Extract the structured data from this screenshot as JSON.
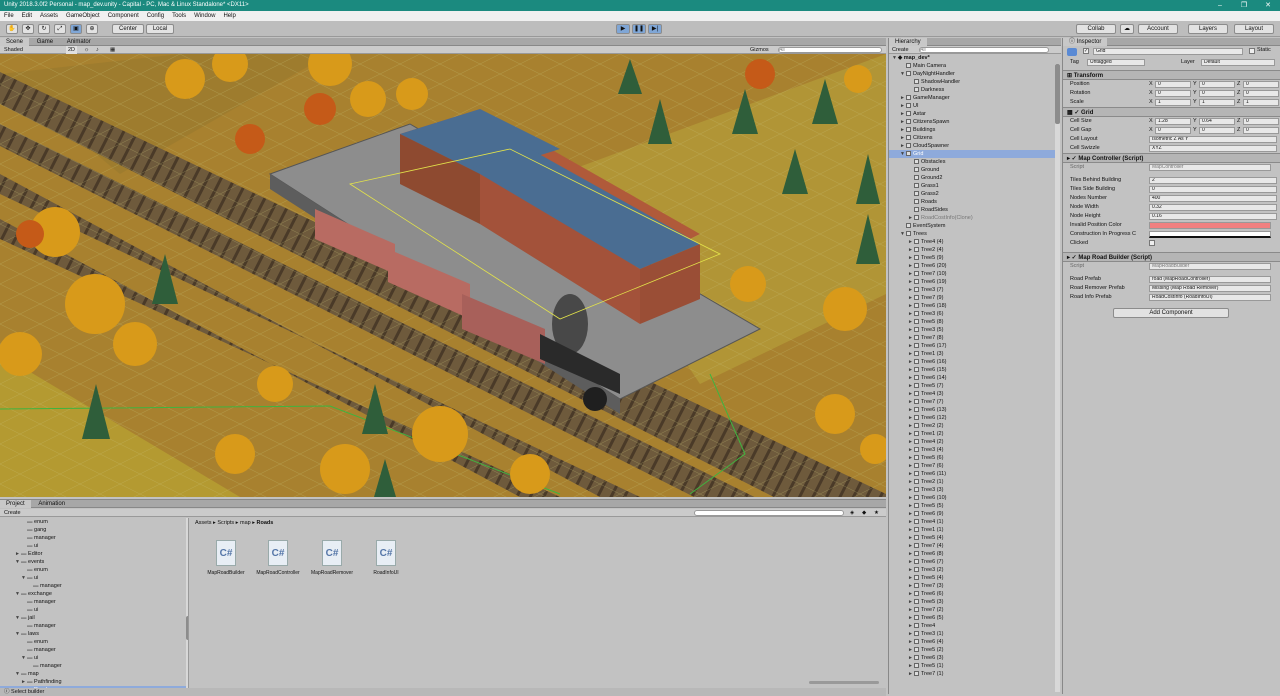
{
  "window": {
    "title": "Unity 2018.3.0f2 Personal - map_dev.unity - Capital - PC, Mac & Linux Standalone* <DX11>"
  },
  "menu": [
    "File",
    "Edit",
    "Assets",
    "GameObject",
    "Component",
    "Config",
    "Tools",
    "Window",
    "Help"
  ],
  "toolbar": {
    "center_label": "Center",
    "local_label": "Local",
    "collab_label": "Collab",
    "account_label": "Account",
    "layers_label": "Layers",
    "layout_label": "Layout"
  },
  "scene": {
    "tabs": [
      "Scene",
      "Game",
      "Animator"
    ],
    "shading": "Shaded",
    "mode2d": "2D",
    "gizmos_label": "Gizmos",
    "search_placeholder": "All"
  },
  "hierarchy": {
    "tab": "Hierarchy",
    "create_label": "Create",
    "search_placeholder": "All",
    "scene_name": "map_dev*",
    "items": [
      {
        "label": "Main Camera",
        "depth": 1,
        "arrow": ""
      },
      {
        "label": "DayNightHandler",
        "depth": 1,
        "arrow": "▼"
      },
      {
        "label": "ShadowHandler",
        "depth": 2,
        "arrow": ""
      },
      {
        "label": "Darkness",
        "depth": 2,
        "arrow": ""
      },
      {
        "label": "GameManager",
        "depth": 1,
        "arrow": "►"
      },
      {
        "label": "UI",
        "depth": 1,
        "arrow": "►"
      },
      {
        "label": "Astar",
        "depth": 1,
        "arrow": "►"
      },
      {
        "label": "CitizensSpawn",
        "depth": 1,
        "arrow": "►"
      },
      {
        "label": "Buildings",
        "depth": 1,
        "arrow": "►"
      },
      {
        "label": "Citizens",
        "depth": 1,
        "arrow": "►"
      },
      {
        "label": "CloudSpawner",
        "depth": 1,
        "arrow": "►"
      },
      {
        "label": "Grid",
        "depth": 1,
        "arrow": "▼",
        "selected": true
      },
      {
        "label": "Obstacles",
        "depth": 2,
        "arrow": ""
      },
      {
        "label": "Ground",
        "depth": 2,
        "arrow": ""
      },
      {
        "label": "Ground2",
        "depth": 2,
        "arrow": ""
      },
      {
        "label": "Grass1",
        "depth": 2,
        "arrow": ""
      },
      {
        "label": "Grass2",
        "depth": 2,
        "arrow": ""
      },
      {
        "label": "Roads",
        "depth": 2,
        "arrow": ""
      },
      {
        "label": "RoadSides",
        "depth": 2,
        "arrow": ""
      },
      {
        "label": "RoadCostInfo(Clone)",
        "depth": 2,
        "arrow": "►",
        "faded": true
      },
      {
        "label": "EventSystem",
        "depth": 1,
        "arrow": ""
      },
      {
        "label": "Trees",
        "depth": 1,
        "arrow": "▼"
      },
      {
        "label": "Tree4 (4)",
        "depth": 2,
        "arrow": "►"
      },
      {
        "label": "Tree2 (4)",
        "depth": 2,
        "arrow": "►"
      },
      {
        "label": "Tree5 (9)",
        "depth": 2,
        "arrow": "►"
      },
      {
        "label": "Tree6 (20)",
        "depth": 2,
        "arrow": "►"
      },
      {
        "label": "Tree7 (10)",
        "depth": 2,
        "arrow": "►"
      },
      {
        "label": "Tree6 (19)",
        "depth": 2,
        "arrow": "►"
      },
      {
        "label": "Tree3 (7)",
        "depth": 2,
        "arrow": "►"
      },
      {
        "label": "Tree7 (9)",
        "depth": 2,
        "arrow": "►"
      },
      {
        "label": "Tree6 (18)",
        "depth": 2,
        "arrow": "►"
      },
      {
        "label": "Tree3 (6)",
        "depth": 2,
        "arrow": "►"
      },
      {
        "label": "Tree5 (8)",
        "depth": 2,
        "arrow": "►"
      },
      {
        "label": "Tree3 (5)",
        "depth": 2,
        "arrow": "►"
      },
      {
        "label": "Tree7 (8)",
        "depth": 2,
        "arrow": "►"
      },
      {
        "label": "Tree6 (17)",
        "depth": 2,
        "arrow": "►"
      },
      {
        "label": "Tree1 (3)",
        "depth": 2,
        "arrow": "►"
      },
      {
        "label": "Tree6 (16)",
        "depth": 2,
        "arrow": "►"
      },
      {
        "label": "Tree6 (15)",
        "depth": 2,
        "arrow": "►"
      },
      {
        "label": "Tree6 (14)",
        "depth": 2,
        "arrow": "►"
      },
      {
        "label": "Tree5 (7)",
        "depth": 2,
        "arrow": "►"
      },
      {
        "label": "Tree4 (3)",
        "depth": 2,
        "arrow": "►"
      },
      {
        "label": "Tree7 (7)",
        "depth": 2,
        "arrow": "►"
      },
      {
        "label": "Tree6 (13)",
        "depth": 2,
        "arrow": "►"
      },
      {
        "label": "Tree6 (12)",
        "depth": 2,
        "arrow": "►"
      },
      {
        "label": "Tree2 (2)",
        "depth": 2,
        "arrow": "►"
      },
      {
        "label": "Tree1 (2)",
        "depth": 2,
        "arrow": "►"
      },
      {
        "label": "Tree4 (2)",
        "depth": 2,
        "arrow": "►"
      },
      {
        "label": "Tree3 (4)",
        "depth": 2,
        "arrow": "►"
      },
      {
        "label": "Tree5 (6)",
        "depth": 2,
        "arrow": "►"
      },
      {
        "label": "Tree7 (6)",
        "depth": 2,
        "arrow": "►"
      },
      {
        "label": "Tree6 (11)",
        "depth": 2,
        "arrow": "►"
      },
      {
        "label": "Tree2 (1)",
        "depth": 2,
        "arrow": "►"
      },
      {
        "label": "Tree3 (3)",
        "depth": 2,
        "arrow": "►"
      },
      {
        "label": "Tree6 (10)",
        "depth": 2,
        "arrow": "►"
      },
      {
        "label": "Tree5 (5)",
        "depth": 2,
        "arrow": "►"
      },
      {
        "label": "Tree6 (9)",
        "depth": 2,
        "arrow": "►"
      },
      {
        "label": "Tree4 (1)",
        "depth": 2,
        "arrow": "►"
      },
      {
        "label": "Tree1 (1)",
        "depth": 2,
        "arrow": "►"
      },
      {
        "label": "Tree5 (4)",
        "depth": 2,
        "arrow": "►"
      },
      {
        "label": "Tree7 (4)",
        "depth": 2,
        "arrow": "►"
      },
      {
        "label": "Tree6 (8)",
        "depth": 2,
        "arrow": "►"
      },
      {
        "label": "Tree6 (7)",
        "depth": 2,
        "arrow": "►"
      },
      {
        "label": "Tree3 (2)",
        "depth": 2,
        "arrow": "►"
      },
      {
        "label": "Tree5 (4)",
        "depth": 2,
        "arrow": "►"
      },
      {
        "label": "Tree7 (3)",
        "depth": 2,
        "arrow": "►"
      },
      {
        "label": "Tree6 (6)",
        "depth": 2,
        "arrow": "►"
      },
      {
        "label": "Tree5 (3)",
        "depth": 2,
        "arrow": "►"
      },
      {
        "label": "Tree7 (2)",
        "depth": 2,
        "arrow": "►"
      },
      {
        "label": "Tree6 (5)",
        "depth": 2,
        "arrow": "►"
      },
      {
        "label": "Tree4",
        "depth": 2,
        "arrow": "►"
      },
      {
        "label": "Tree3 (1)",
        "depth": 2,
        "arrow": "►"
      },
      {
        "label": "Tree6 (4)",
        "depth": 2,
        "arrow": "►"
      },
      {
        "label": "Tree5 (2)",
        "depth": 2,
        "arrow": "►"
      },
      {
        "label": "Tree6 (3)",
        "depth": 2,
        "arrow": "►"
      },
      {
        "label": "Tree5 (1)",
        "depth": 2,
        "arrow": "►"
      },
      {
        "label": "Tree7 (1)",
        "depth": 2,
        "arrow": "►"
      }
    ]
  },
  "inspector": {
    "tab": "Inspector",
    "object_name": "Grid",
    "static_label": "Static",
    "tag_label": "Tag",
    "tag_value": "Untagged",
    "layer_label": "Layer",
    "layer_value": "Default",
    "transform": {
      "title": "Transform",
      "rows": [
        {
          "label": "Position",
          "x": "0",
          "y": "0",
          "z": "0"
        },
        {
          "label": "Rotation",
          "x": "0",
          "y": "0",
          "z": "0"
        },
        {
          "label": "Scale",
          "x": "1",
          "y": "1",
          "z": "1"
        }
      ]
    },
    "grid": {
      "title": "Grid",
      "rows": [
        {
          "label": "Cell Size",
          "x": "1.28",
          "y": "0.64",
          "z": "0"
        },
        {
          "label": "Cell Gap",
          "x": "0",
          "y": "0",
          "z": "0"
        }
      ],
      "layout_label": "Cell Layout",
      "layout_value": "Isometric Z As Y",
      "swizzle_label": "Cell Swizzle",
      "swizzle_value": "XYZ"
    },
    "map_controller": {
      "title": "Map Controller (Script)",
      "script_label": "Script",
      "script_value": "MapController",
      "rows": [
        {
          "label": "Tiles Behind Building",
          "value": "2"
        },
        {
          "label": "Tiles Side Building",
          "value": "0"
        },
        {
          "label": "Nodes Number",
          "value": "400"
        },
        {
          "label": "Node Width",
          "value": "0.32"
        },
        {
          "label": "Node Height",
          "value": "0.16"
        }
      ],
      "invalid_color_label": "Invalid Position Color",
      "construction_label": "Construction In Progress C",
      "clicked_label": "Clicked"
    },
    "map_road_builder": {
      "title": "Map Road Builder (Script)",
      "script_label": "Script",
      "script_value": "MapRoadBuilder",
      "rows": [
        {
          "label": "Road Prefab",
          "value": "road (MapRoadController)"
        },
        {
          "label": "Road Remover Prefab",
          "value": "Missing (Map Road Remover)"
        },
        {
          "label": "Road Info Prefab",
          "value": "RoadCostInfo (RoadInfoUI)"
        }
      ]
    },
    "add_component_label": "Add Component"
  },
  "project": {
    "tabs": [
      "Project",
      "Animation"
    ],
    "create_label": "Create",
    "breadcrumb": [
      "Assets",
      "Scripts",
      "map",
      "Roads"
    ],
    "tree": [
      {
        "label": "enum",
        "depth": 3,
        "arrow": ""
      },
      {
        "label": "gang",
        "depth": 3,
        "arrow": ""
      },
      {
        "label": "manager",
        "depth": 3,
        "arrow": ""
      },
      {
        "label": "ui",
        "depth": 3,
        "arrow": ""
      },
      {
        "label": "Editor",
        "depth": 2,
        "arrow": "►"
      },
      {
        "label": "events",
        "depth": 2,
        "arrow": "▼"
      },
      {
        "label": "enum",
        "depth": 3,
        "arrow": ""
      },
      {
        "label": "ui",
        "depth": 3,
        "arrow": "▼"
      },
      {
        "label": "manager",
        "depth": 4,
        "arrow": ""
      },
      {
        "label": "exchange",
        "depth": 2,
        "arrow": "▼"
      },
      {
        "label": "manager",
        "depth": 3,
        "arrow": ""
      },
      {
        "label": "ui",
        "depth": 3,
        "arrow": ""
      },
      {
        "label": "jail",
        "depth": 2,
        "arrow": "▼"
      },
      {
        "label": "manager",
        "depth": 3,
        "arrow": ""
      },
      {
        "label": "laws",
        "depth": 2,
        "arrow": "▼"
      },
      {
        "label": "enum",
        "depth": 3,
        "arrow": ""
      },
      {
        "label": "manager",
        "depth": 3,
        "arrow": ""
      },
      {
        "label": "ui",
        "depth": 3,
        "arrow": "▼"
      },
      {
        "label": "manager",
        "depth": 4,
        "arrow": ""
      },
      {
        "label": "map",
        "depth": 2,
        "arrow": "▼"
      },
      {
        "label": "Pathfinding",
        "depth": 3,
        "arrow": "►"
      },
      {
        "label": "Roads",
        "depth": 3,
        "arrow": "",
        "selected": true
      }
    ],
    "assets": [
      {
        "name": "MapRoadBuilder",
        "icon": "C#"
      },
      {
        "name": "MapRoadController",
        "icon": "C#"
      },
      {
        "name": "MapRoadRemover",
        "icon": "C#"
      },
      {
        "name": "RoadInfoUI",
        "icon": "C#"
      }
    ]
  },
  "status": {
    "text": "Select builder"
  },
  "colors": {
    "titlebar": "#1b8a7f",
    "selection": "#8eaadb",
    "invalid_color": "#f08080"
  }
}
